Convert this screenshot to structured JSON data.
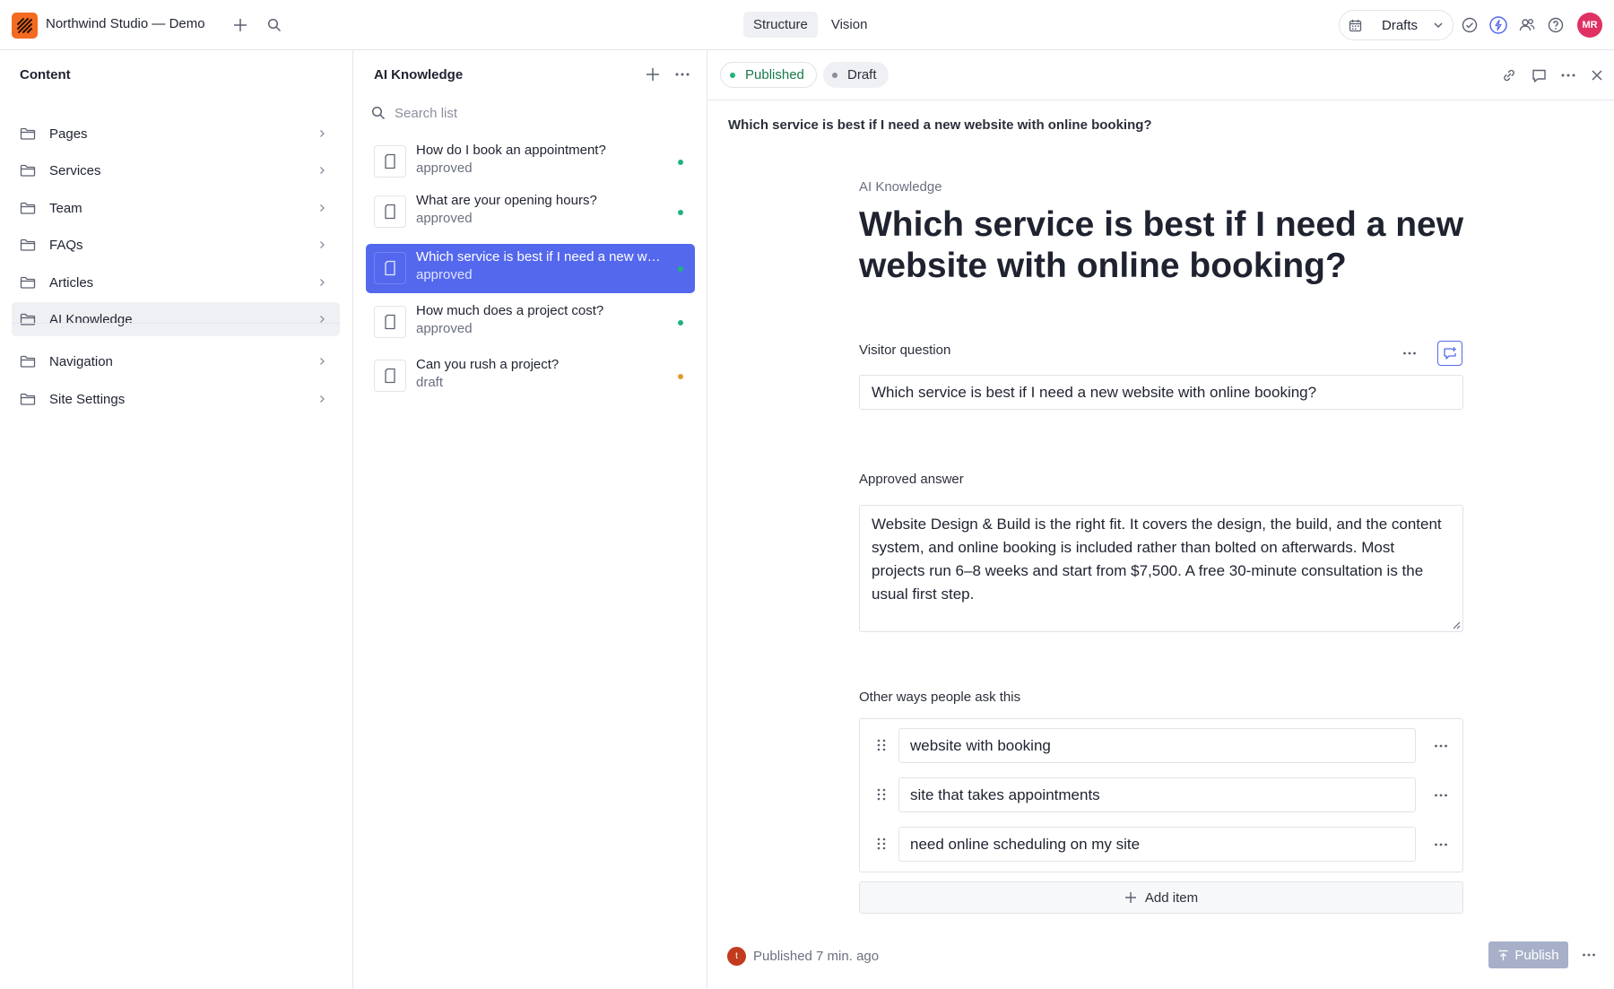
{
  "app": {
    "title": "Northwind Studio — Demo",
    "tabs": [
      {
        "label": "Structure",
        "active": true
      },
      {
        "label": "Vision",
        "active": false
      }
    ],
    "perspective_label": "Drafts",
    "user_initials": "MR",
    "colors": {
      "brand": "#f36b21",
      "accent": "#5468ee",
      "avatar": "#e03163"
    }
  },
  "content": {
    "heading": "Content",
    "items": [
      {
        "label": "Pages"
      },
      {
        "label": "Services"
      },
      {
        "label": "Team"
      },
      {
        "label": "FAQs"
      },
      {
        "label": "Articles"
      },
      {
        "label": "AI Knowledge",
        "active": true
      },
      {
        "label": "Navigation"
      },
      {
        "label": "Site Settings"
      }
    ]
  },
  "list": {
    "heading": "AI Knowledge",
    "search_placeholder": "Search list",
    "items": [
      {
        "title": "How do I book an appointment?",
        "status": "approved",
        "dot_color": "#1fb37a"
      },
      {
        "title": "What are your opening hours?",
        "status": "approved",
        "dot_color": "#1fb37a"
      },
      {
        "title": "Which service is best if I need a new website with online booking?",
        "status": "approved",
        "dot_color": "#1fb37a",
        "selected": true
      },
      {
        "title": "How much does a project cost?",
        "status": "approved",
        "dot_color": "#1fb37a"
      },
      {
        "title": "Can you rush a project?",
        "status": "draft",
        "dot_color": "#e49a2b"
      }
    ]
  },
  "document": {
    "published_label": "Published",
    "draft_label": "Draft",
    "breadcrumb": "Which service is best if I need a new website with online booking?",
    "type_label": "AI Knowledge",
    "title": "Which service is best if I need a new website with online booking?",
    "question_label": "Visitor question",
    "question_value": "Which service is best if I need a new website with online booking?",
    "answer_label": "Approved answer",
    "answer_value": "Website Design & Build is the right fit. It covers the design, the build, and the content system, and online booking is included rather than bolted on afterwards. Most projects run 6–8 weeks and start from $7,500. A free 30-minute consultation is the usual first step.",
    "aliases_label": "Other ways people ask this",
    "aliases": [
      "website with booking",
      "site that takes appointments",
      "need online scheduling on my site"
    ],
    "add_item_label": "Add item",
    "footer": {
      "user_initial": "t",
      "status": "Published 7 min. ago",
      "publish_label": "Publish"
    }
  }
}
